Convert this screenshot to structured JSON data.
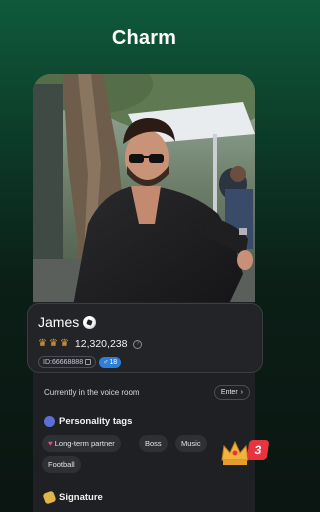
{
  "header": {
    "title": "Charm"
  },
  "profile": {
    "name": "James",
    "coins": "12,320,238",
    "id": "ID:66668888",
    "level": "18"
  },
  "voice_room": {
    "status_text": "Currently in the voice room",
    "enter_label": "Enter"
  },
  "personality": {
    "title": "Personality tags",
    "tags": [
      "Long-term partner",
      "Boss",
      "Music",
      "Football"
    ]
  },
  "signature": {
    "title": "Signature"
  },
  "badge": {
    "count": "3"
  },
  "colors": {
    "accent_green": "#0f5a3c",
    "level_blue": "#2f7fd8",
    "badge_red": "#e8343e",
    "crown_gold": "#e6a23c"
  },
  "icons": [
    "football-icon",
    "crown-icon",
    "info-icon",
    "copy-icon",
    "male-icon",
    "chevron-right-icon",
    "personality-icon",
    "heart-icon",
    "signature-icon"
  ]
}
